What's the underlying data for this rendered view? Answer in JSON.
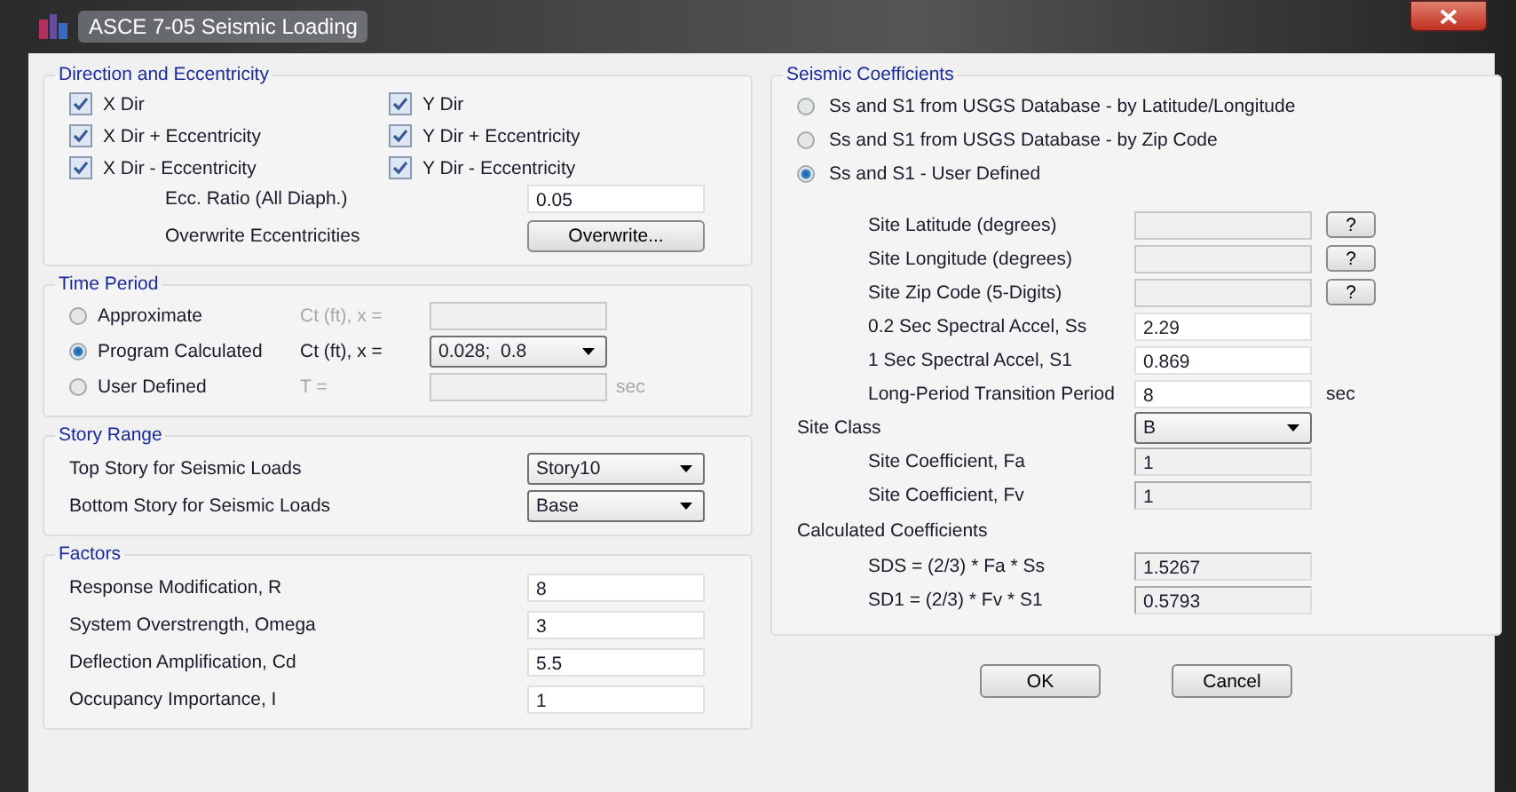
{
  "window": {
    "title": "ASCE 7-05 Seismic Loading"
  },
  "direction_and_eccentricity": {
    "title": "Direction and Eccentricity",
    "checkboxes": [
      {
        "label": "X Dir",
        "checked": true
      },
      {
        "label": "Y Dir",
        "checked": true
      },
      {
        "label": "X Dir + Eccentricity",
        "checked": true
      },
      {
        "label": "Y Dir + Eccentricity",
        "checked": true
      },
      {
        "label": "X Dir - Eccentricity",
        "checked": true
      },
      {
        "label": "Y Dir - Eccentricity",
        "checked": true
      }
    ],
    "ecc_ratio": {
      "label": "Ecc. Ratio (All Diaph.)",
      "value": "0.05"
    },
    "overwrite": {
      "label": "Overwrite Eccentricities",
      "button": "Overwrite..."
    }
  },
  "time_period": {
    "title": "Time Period",
    "options": [
      {
        "label": "Approximate",
        "selected": false,
        "param_label": "Ct (ft), x =",
        "kind": "field",
        "disabled": true
      },
      {
        "label": "Program Calculated",
        "selected": true,
        "param_label": "Ct (ft), x =",
        "kind": "dropdown",
        "disabled": false,
        "value": "0.028;  0.8"
      },
      {
        "label": "User Defined",
        "selected": false,
        "param_label": "T =",
        "kind": "field",
        "disabled": true,
        "unit": "sec"
      }
    ]
  },
  "story_range": {
    "title": "Story Range",
    "rows": [
      {
        "label": "Top Story for Seismic Loads",
        "value": "Story10"
      },
      {
        "label": "Bottom Story for Seismic Loads",
        "value": "Base"
      }
    ]
  },
  "factors": {
    "title": "Factors",
    "rows": [
      {
        "label": "Response Modification, R",
        "value": "8"
      },
      {
        "label": "System Overstrength, Omega",
        "value": "3"
      },
      {
        "label": "Deflection Amplification, Cd",
        "value": "5.5"
      },
      {
        "label": "Occupancy Importance, I",
        "value": "1"
      }
    ]
  },
  "seismic_coefficients": {
    "title": "Seismic Coefficients",
    "options": [
      {
        "label": "Ss and S1 from USGS Database - by Latitude/Longitude",
        "selected": false
      },
      {
        "label": "Ss and S1 from USGS Database - by Zip Code",
        "selected": false
      },
      {
        "label": "Ss and S1 - User Defined",
        "selected": true
      }
    ],
    "rows": [
      {
        "kind": "input",
        "label": "Site Latitude (degrees)",
        "disabled": true,
        "help": "?"
      },
      {
        "kind": "input",
        "label": "Site Longitude (degrees)",
        "disabled": true,
        "help": "?"
      },
      {
        "kind": "input",
        "label": "Site Zip Code (5-Digits)",
        "disabled": true,
        "help": "?"
      },
      {
        "kind": "input",
        "label": "0.2 Sec Spectral Accel, Ss",
        "disabled": false,
        "value": "2.29"
      },
      {
        "kind": "input",
        "label": "1 Sec Spectral Accel, S1",
        "disabled": false,
        "value": "0.869"
      },
      {
        "kind": "input",
        "label": "Long-Period Transition Period",
        "disabled": false,
        "value": "8",
        "unit": "sec"
      },
      {
        "kind": "dropdown",
        "label": "Site Class",
        "value": "B"
      },
      {
        "kind": "readonly",
        "label": "Site Coefficient, Fa",
        "value": "1"
      },
      {
        "kind": "readonly",
        "label": "Site Coefficient, Fv",
        "value": "1"
      },
      {
        "kind": "heading",
        "label": "Calculated Coefficients"
      },
      {
        "kind": "readonly",
        "label": "SDS = (2/3) * Fa * Ss",
        "value": "1.5267"
      },
      {
        "kind": "readonly",
        "label": "SD1 = (2/3) * Fv * S1",
        "value": "0.5793"
      }
    ]
  },
  "buttons": [
    "OK",
    "Cancel"
  ]
}
